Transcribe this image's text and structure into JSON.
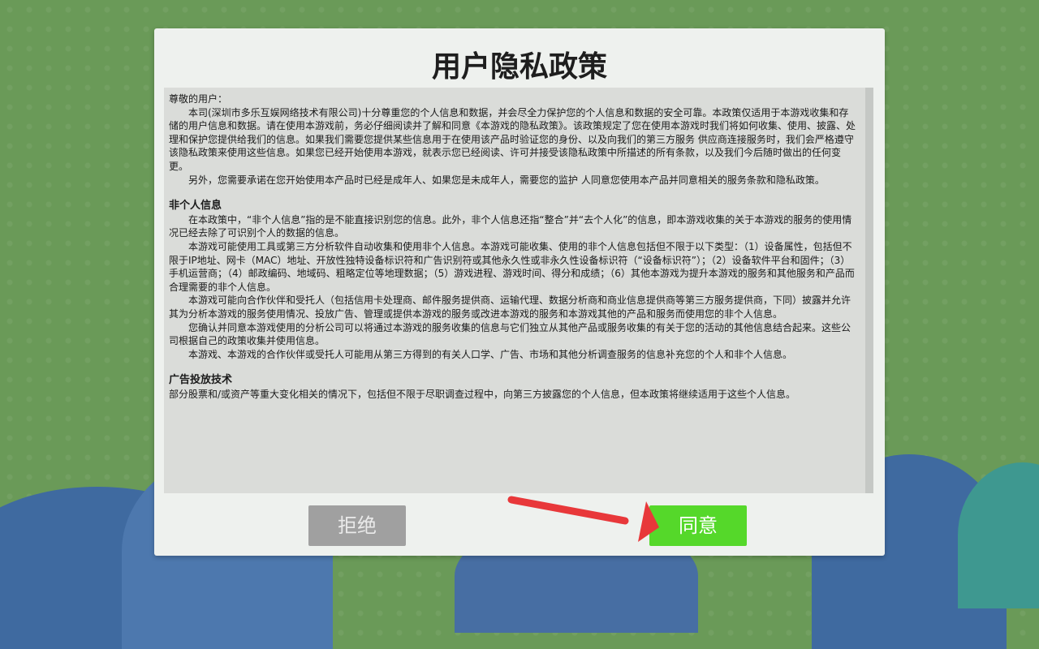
{
  "dialog": {
    "title": "用户隐私政策",
    "greeting": "尊敬的用户：",
    "intro_p1": "本司(深圳市多乐互娱网络技术有限公司)十分尊重您的个人信息和数据，并会尽全力保护您的个人信息和数据的安全可靠。本政策仅适用于本游戏收集和存储的用户信息和数据。请在使用本游戏前，务必仔细阅读并了解和同意《本游戏的隐私政策》。该政策规定了您在使用本游戏时我们将如何收集、使用、披露、处理和保护您提供给我们的信息。如果我们需要您提供某些信息用于在使用该产品时验证您的身份、以及向我们的第三方服务 供应商连接服务时，我们会严格遵守该隐私政策来使用这些信息。如果您已经开始使用本游戏，就表示您已经阅读、许可并接受该隐私政策中所描述的所有条款，以及我们今后随时做出的任何变更。",
    "intro_p2": "另外，您需要承诺在您开始使用本产品时已经是成年人、如果您是未成年人，需要您的监护 人同意您使用本产品并同意相关的服务条款和隐私政策。",
    "section1_title": "非个人信息",
    "section1_p1": "在本政策中，“非个人信息”指的是不能直接识别您的信息。此外，非个人信息还指“整合”并“去个人化”的信息，即本游戏收集的关于本游戏的服务的使用情况已经去除了可识别个人的数据的信息。",
    "section1_p2": "本游戏可能使用工具或第三方分析软件自动收集和使用非个人信息。本游戏可能收集、使用的非个人信息包括但不限于以下类型：（1）设备属性，包括但不限于IP地址、网卡（MAC）地址、开放性独特设备标识符和广告识别符或其他永久性或非永久性设备标识符（“设备标识符”）；（2）设备软件平台和固件；（3）手机运营商；（4）邮政编码、地域码、粗略定位等地理数据；（5）游戏进程、游戏时间、得分和成绩；（6）其他本游戏为提升本游戏的服务和其他服务和产品而合理需要的非个人信息。",
    "section1_p3": "本游戏可能向合作伙伴和受托人（包括信用卡处理商、邮件服务提供商、运输代理、数据分析商和商业信息提供商等第三方服务提供商，下同）披露并允许其为分析本游戏的服务使用情况、投放广告、管理或提供本游戏的服务或改进本游戏的服务和本游戏其他的产品和服务而使用您的非个人信息。",
    "section1_p4": "您确认并同意本游戏使用的分析公司可以将通过本游戏的服务收集的信息与它们独立从其他产品或服务收集的有关于您的活动的其他信息结合起来。这些公司根据自己的政策收集并使用信息。",
    "section1_p5": "本游戏、本游戏的合作伙伴或受托人可能用从第三方得到的有关人口学、广告、市场和其他分析调查服务的信息补充您的个人和非个人信息。",
    "section2_title": "广告投放技术",
    "section2_p1": "部分股票和/或资产等重大变化相关的情况下，包括但不限于尽职调查过程中，向第三方披露您的个人信息，但本政策将继续适用于这些个人信息。"
  },
  "buttons": {
    "reject_label": "拒绝",
    "agree_label": "同意"
  },
  "colors": {
    "agree_button": "#55d82a",
    "reject_button": "#a0a0a0",
    "arrow": "#e8383a",
    "background": "#6a9a58"
  }
}
